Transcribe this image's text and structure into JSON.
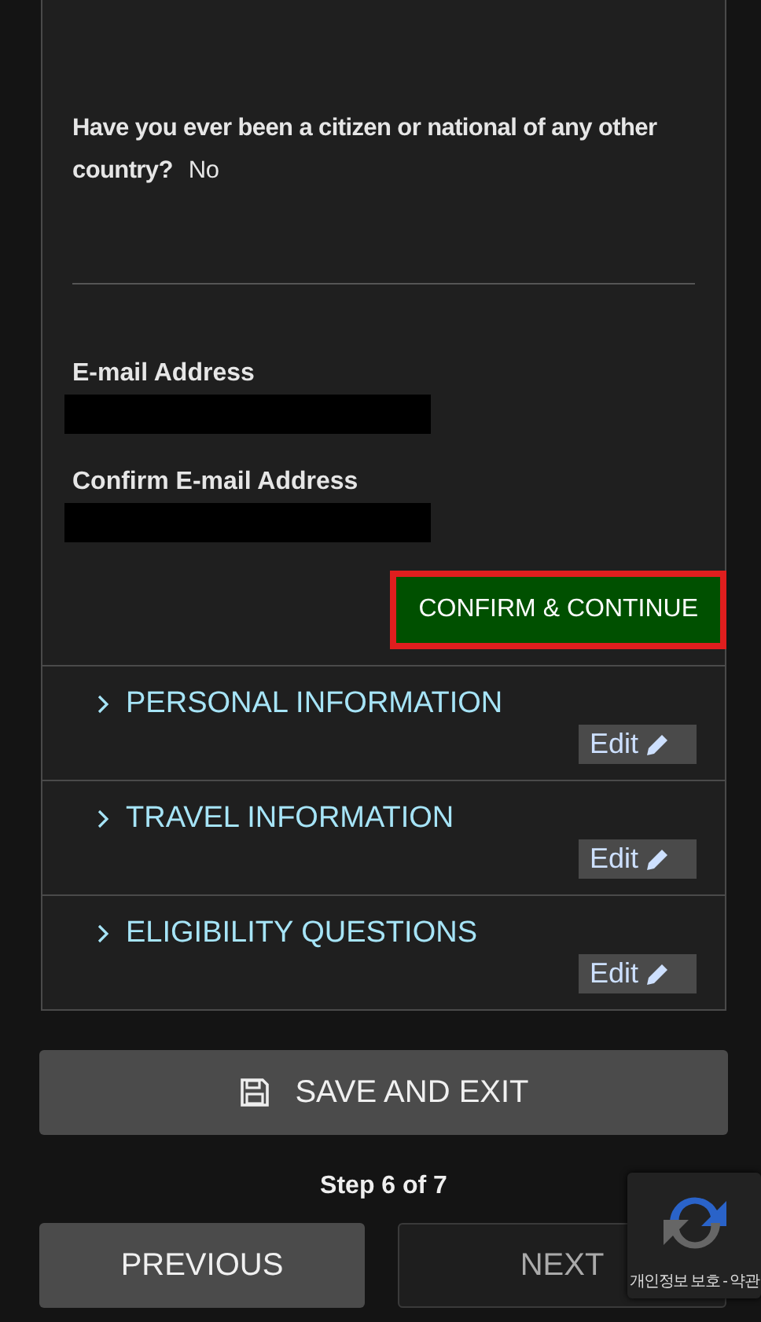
{
  "question": {
    "label": "Have you ever been a citizen or national of any other country?",
    "answer": "No"
  },
  "email_fields": [
    {
      "label": "E-mail Address",
      "value_redacted": true
    },
    {
      "label": "Confirm E-mail Address",
      "value_redacted": true
    }
  ],
  "confirm_button": {
    "label": "CONFIRM & CONTINUE",
    "highlighted": true
  },
  "sections": [
    {
      "title": "PERSONAL INFORMATION",
      "expanded": false,
      "edit_label": "Edit"
    },
    {
      "title": "TRAVEL INFORMATION",
      "expanded": false,
      "edit_label": "Edit"
    },
    {
      "title": "ELIGIBILITY QUESTIONS",
      "expanded": false,
      "edit_label": "Edit"
    }
  ],
  "save_button": {
    "label": "SAVE AND EXIT"
  },
  "step": "Step 6 of 7",
  "nav_buttons": [
    {
      "label": "PREVIOUS",
      "disabled": false
    },
    {
      "label": "NEXT",
      "disabled": true
    }
  ],
  "recaptcha_badge": {
    "text": "개인정보 보호 - 약관"
  }
}
